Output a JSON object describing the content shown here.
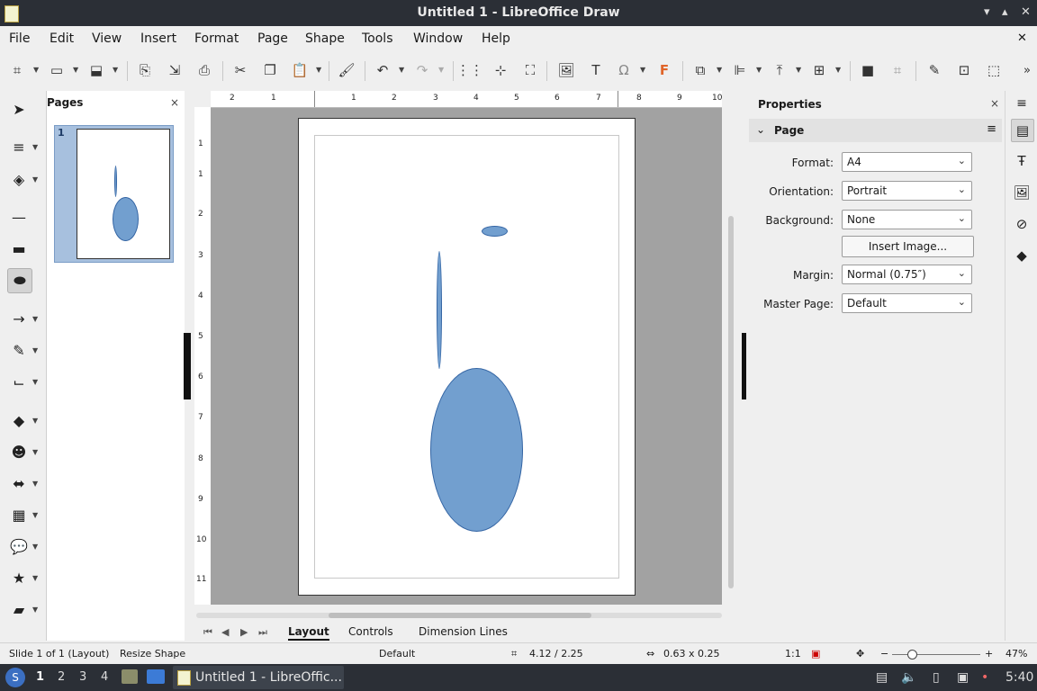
{
  "window": {
    "title": "Untitled 1 - LibreOffice Draw"
  },
  "menu": [
    "File",
    "Edit",
    "View",
    "Insert",
    "Format",
    "Page",
    "Shape",
    "Tools",
    "Window",
    "Help"
  ],
  "pages_panel": {
    "title": "Pages",
    "page_number": "1"
  },
  "rulers": {
    "h": [
      "2",
      "1",
      "1",
      "2",
      "3",
      "4",
      "5",
      "6",
      "7",
      "8",
      "9",
      "10"
    ],
    "v": [
      "1",
      "1",
      "2",
      "3",
      "4",
      "5",
      "6",
      "7",
      "8",
      "9",
      "10",
      "11"
    ]
  },
  "tabs": [
    "Layout",
    "Controls",
    "Dimension Lines"
  ],
  "properties": {
    "title": "Properties",
    "section": "Page",
    "format_label": "Format:",
    "format_value": "A4",
    "orientation_label": "Orientation:",
    "orientation_value": "Portrait",
    "background_label": "Background:",
    "background_value": "None",
    "insert_image": "Insert Image...",
    "margin_label": "Margin:",
    "margin_value": "Normal (0.75″)",
    "master_label": "Master Page:",
    "master_value": "Default"
  },
  "status": {
    "slide": "Slide 1 of 1 (Layout)",
    "action": "Resize Shape",
    "style": "Default",
    "position": "4.12 / 2.25",
    "size": "0.63 x 0.25",
    "scale": "1:1",
    "zoom": "47%"
  },
  "taskbar": {
    "workspaces": [
      "1",
      "2",
      "3",
      "4"
    ],
    "window_label": "Untitled 1 - LibreOffic...",
    "clock": "5:40"
  },
  "colors": {
    "shape_fill": "#729fcf",
    "shape_stroke": "#3465a4"
  }
}
